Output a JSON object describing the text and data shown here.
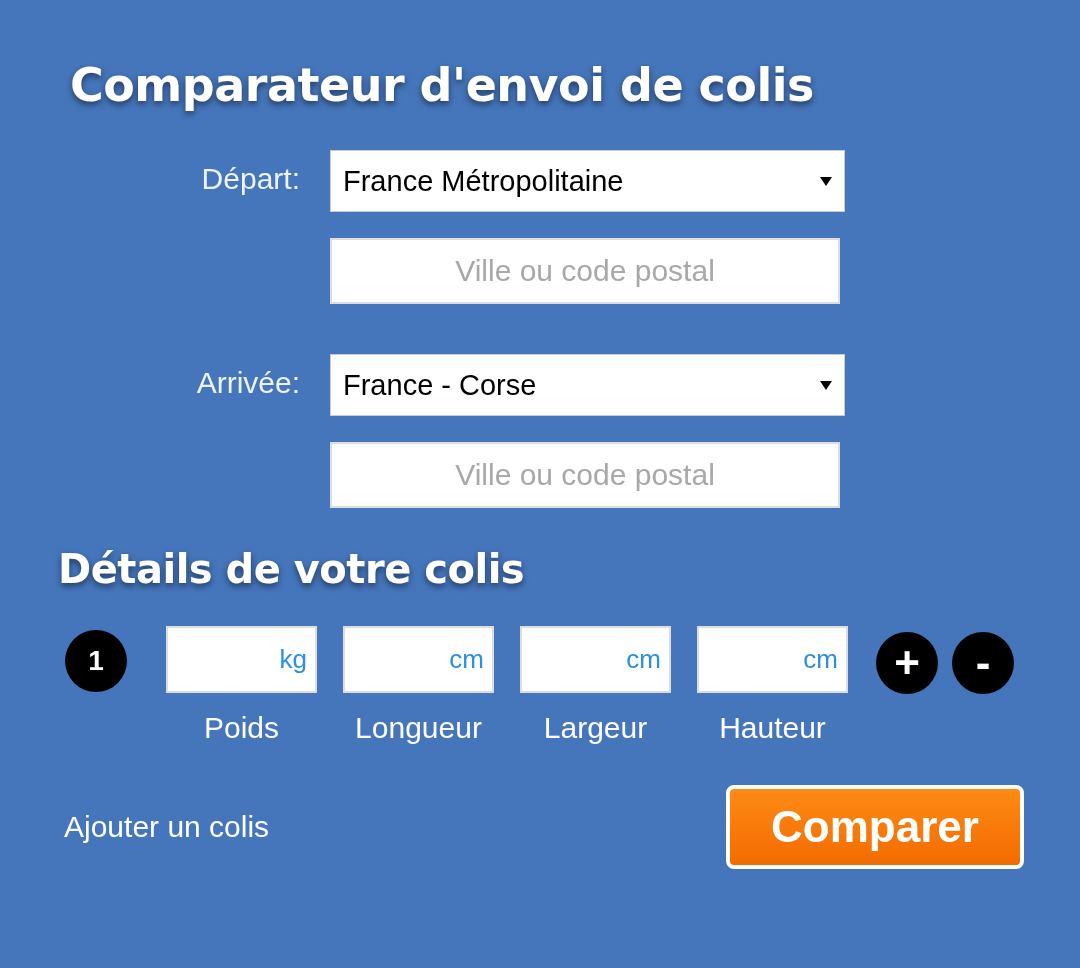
{
  "title": "Comparateur d'envoi de colis",
  "locations": [
    {
      "label": "Départ:",
      "country": "France Métropolitaine",
      "placeholder": "Ville ou code postal"
    },
    {
      "label": "Arrivée:",
      "country": "France - Corse",
      "placeholder": "Ville ou code postal"
    }
  ],
  "details_title": "Détails de votre colis",
  "parcels": [
    {
      "number": "1",
      "fields": [
        {
          "unit": "kg",
          "label": "Poids"
        },
        {
          "unit": "cm",
          "label": "Longueur"
        },
        {
          "unit": "cm",
          "label": "Largeur"
        },
        {
          "unit": "cm",
          "label": "Hauteur"
        }
      ],
      "add": "+",
      "remove": "-"
    }
  ],
  "add_link": "Ajouter un colis",
  "submit": "Comparer"
}
